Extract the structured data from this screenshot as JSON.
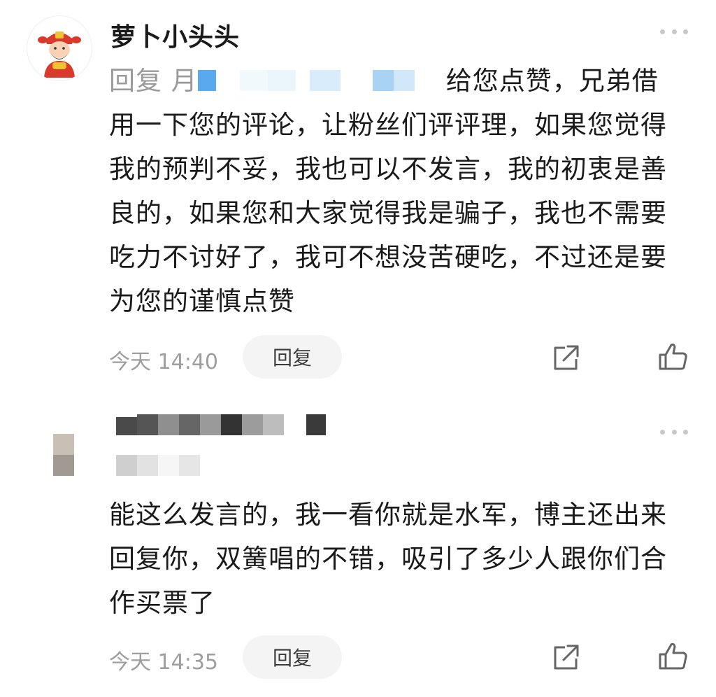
{
  "comments": [
    {
      "username": "萝卜小头头",
      "reply_prefix": "回复",
      "reply_target_visible": "月",
      "body": "给您点赞，兄弟借用一下您的评论，让粉丝们评评理，如果您觉得我的预判不妥，我也可以不发言，我的初衷是善良的，如果您和大家觉得我是骗子，我也不需要吃力不讨好了，我可不想没苦硬吃，不过还是要为您的谨慎点赞",
      "time": "今天 14:40",
      "reply_label": "回复",
      "icons": {
        "avatar": "god-of-wealth-avatar",
        "more": "more-dots-icon",
        "share": "share-icon",
        "like": "thumbs-up-icon"
      }
    },
    {
      "username_redacted": true,
      "body": "能这么发言的，我一看你就是水军，博主还出来回复你，双簧唱的不错，吸引了多少人跟你们合作买票了",
      "time": "今天 14:35",
      "reply_label": "回复",
      "icons": {
        "more": "more-dots-icon",
        "share": "share-icon",
        "like": "thumbs-up-icon"
      }
    }
  ],
  "colors": {
    "text": "#1a1a1a",
    "meta": "#9e9e9e",
    "reply_bg": "#f4f4f4",
    "redaction_blue": "#5aa8ee"
  }
}
